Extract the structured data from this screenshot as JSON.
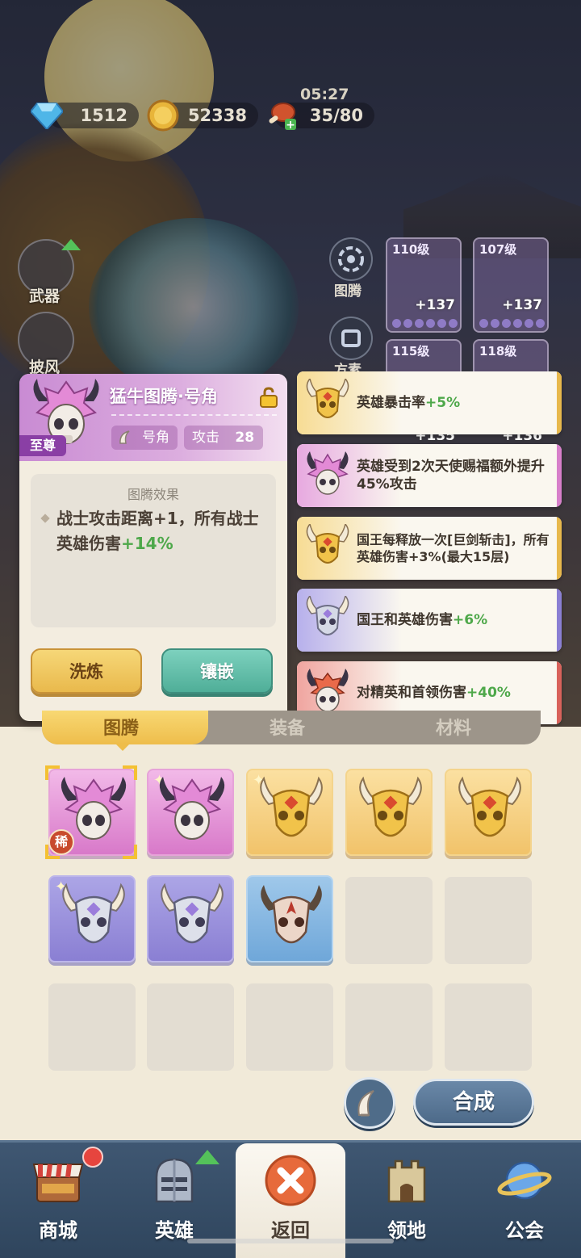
{
  "resources": {
    "gems": "1512",
    "gold": "52338",
    "stamina": "35/80",
    "stamina_timer": "05:27"
  },
  "hero_slots": {
    "weapon": "武器",
    "cloak": "披风"
  },
  "side_menu": {
    "totem": "图腾",
    "slot2": "方素"
  },
  "equipped": [
    {
      "level": "110级",
      "plus": "+137"
    },
    {
      "level": "107级",
      "plus": "+137"
    },
    {
      "level": "115级",
      "plus": "+135"
    },
    {
      "level": "118级",
      "plus": "+136"
    }
  ],
  "detail": {
    "title": "猛牛图腾·号角",
    "rank": "至尊",
    "slot_name": "号角",
    "stat_label": "攻击",
    "stat_value": "28",
    "effect_header": "图腾效果",
    "effect_text_1": "战士攻击距离+1，所有战士英雄伤害",
    "effect_value": "+14%",
    "refine_label": "洗炼",
    "inlay_label": "镶嵌"
  },
  "effects": [
    {
      "text": "英雄暴击率",
      "value": "+5%",
      "tier": "gold"
    },
    {
      "text": "英雄受到2次天使赐福额外提升45%攻击",
      "value": "",
      "tier": "purple"
    },
    {
      "text": "国王每释放一次[巨剑斩击]，所有英雄伤害+3%(最大15层)",
      "value": "",
      "tier": "gold"
    },
    {
      "text": "国王和英雄伤害",
      "value": "+6%",
      "tier": "violet"
    },
    {
      "text": "对精英和首领伤害",
      "value": "+40%",
      "tier": "red"
    }
  ],
  "tabs": {
    "totem": "图腾",
    "equipment": "装备",
    "material": "材料"
  },
  "inventory": {
    "rare_badge": "稀"
  },
  "combine_label": "合成",
  "nav": {
    "shop": "商城",
    "hero": "英雄",
    "back": "返回",
    "territory": "领地",
    "guild": "公会"
  },
  "colors": {
    "accent_green": "#4ea84a",
    "panel_bg": "#f3ede0",
    "nav_bg": "#3f5772"
  }
}
